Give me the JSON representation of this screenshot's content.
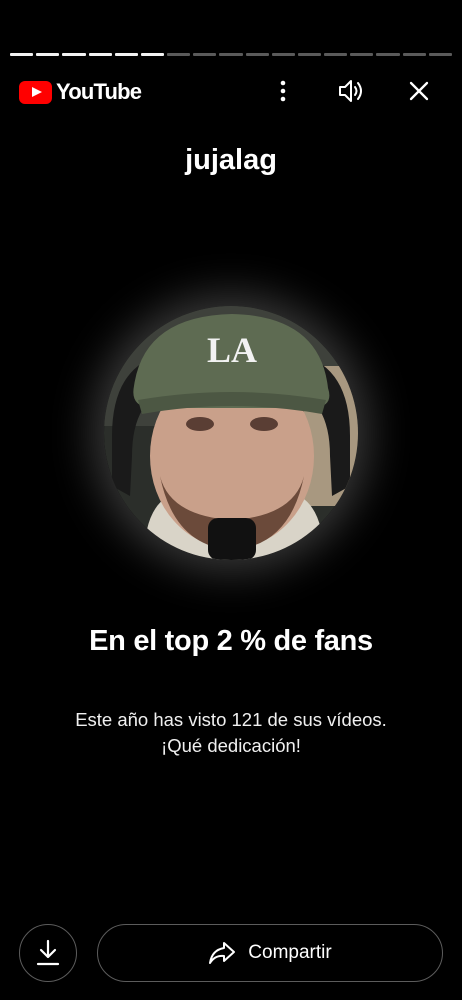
{
  "story": {
    "segments_total": 17,
    "segments_completed": 6
  },
  "header": {
    "logo_text": "YouTube",
    "brand_color": "#ff0000"
  },
  "channel": {
    "name": "jujalag"
  },
  "stat": {
    "headline": "En el top 2 % de fans",
    "line1": "Este año has visto 121 de sus vídeos.",
    "line2": "¡Qué dedicación!"
  },
  "actions": {
    "share_label": "Compartir"
  }
}
